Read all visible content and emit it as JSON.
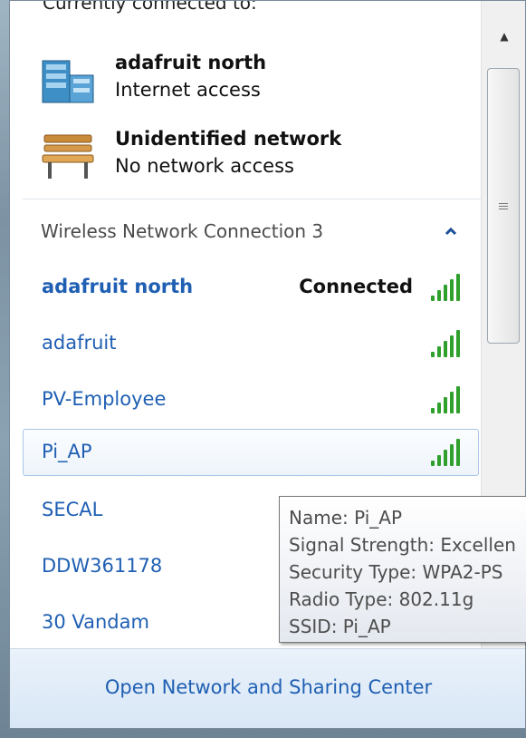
{
  "popup": {
    "section_title": "Currently connected to:",
    "current_connections": [
      {
        "name": "adafruit north",
        "status": "Internet access",
        "icon": "network-building-icon"
      },
      {
        "name": "Unidentified network",
        "status": "No network access",
        "icon": "park-bench-icon"
      }
    ],
    "wireless_group": {
      "title": "Wireless Network Connection 3",
      "collapse_icon": "chevron-up-icon"
    },
    "networks": [
      {
        "name": "adafruit north",
        "status": "Connected"
      },
      {
        "name": "adafruit",
        "status": ""
      },
      {
        "name": "PV-Employee",
        "status": ""
      },
      {
        "name": "Pi_AP",
        "status": ""
      },
      {
        "name": "SECAL",
        "status": ""
      },
      {
        "name": "DDW361178",
        "status": ""
      },
      {
        "name": "30 Vandam",
        "status": ""
      }
    ],
    "footer_link": "Open Network and Sharing Center"
  },
  "tooltip": {
    "name": "Name: Pi_AP",
    "signal": "Signal Strength: Excellen",
    "security": "Security Type: WPA2-PS",
    "radio": "Radio Type: 802.11g",
    "ssid": "SSID: Pi_AP"
  },
  "colors": {
    "link_blue": "#1f5fb3",
    "signal_green": "#2ea02b",
    "selection_border": "#a9c5e6"
  }
}
